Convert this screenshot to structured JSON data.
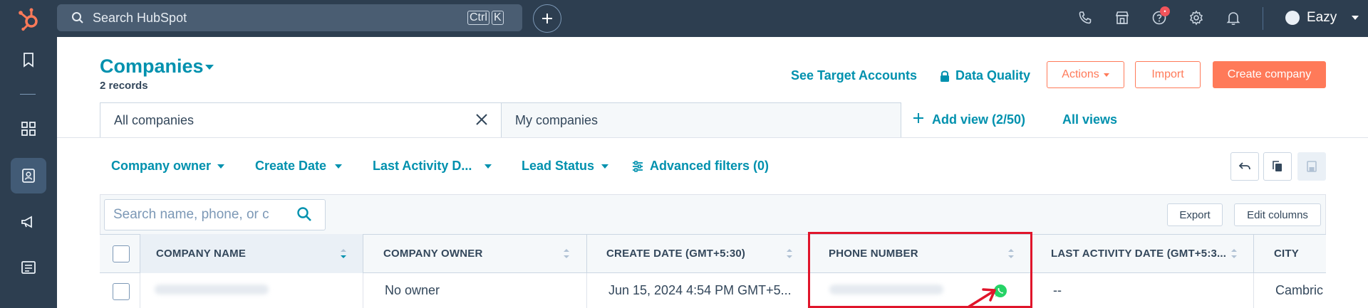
{
  "topbar": {
    "search_label": "Search HubSpot",
    "kbd_ctrl": "Ctrl",
    "kbd_k": "K",
    "notification_count": "•",
    "account_name": "Eazy"
  },
  "header": {
    "title": "Companies",
    "records": "2 records",
    "see_target_accounts": "See Target Accounts",
    "data_quality": "Data Quality",
    "actions": "Actions",
    "import": "Import",
    "create_company": "Create company"
  },
  "views": {
    "tabs": [
      "All companies",
      "My companies"
    ],
    "add_view": "Add view (2/50)",
    "all_views": "All views"
  },
  "filters": {
    "company_owner": "Company owner",
    "create_date": "Create Date",
    "last_activity_date": "Last Activity D...",
    "lead_status": "Lead Status",
    "advanced_filters": "Advanced filters (0)"
  },
  "table": {
    "search_placeholder": "Search name, phone, or c",
    "export": "Export",
    "edit_columns": "Edit columns",
    "columns": [
      "COMPANY NAME",
      "COMPANY OWNER",
      "CREATE DATE (GMT+5:30)",
      "PHONE NUMBER",
      "LAST ACTIVITY DATE (GMT+5:3...",
      "CITY"
    ],
    "rows": [
      {
        "company_name": "",
        "company_owner": "No owner",
        "create_date": "Jun 15, 2024 4:54 PM GMT+5...",
        "phone_number": "",
        "last_activity": "--",
        "city": "Cambric"
      }
    ]
  },
  "colors": {
    "topbar": "#2d3e50",
    "accent": "#0091ae",
    "brand_orange": "#ff7a59",
    "highlight_red": "#e0152b",
    "whatsapp_green": "#25d366"
  },
  "icons": [
    "hubspot-logo-icon",
    "search-icon",
    "plus-icon",
    "phone-icon",
    "marketplace-icon",
    "help-icon",
    "settings-icon",
    "bell-icon",
    "bookmark-icon",
    "grid-icon",
    "contacts-icon",
    "megaphone-icon",
    "content-icon",
    "lock-icon",
    "close-icon",
    "filters-icon",
    "undo-icon",
    "copy-icon",
    "save-icon",
    "whatsapp-icon"
  ]
}
